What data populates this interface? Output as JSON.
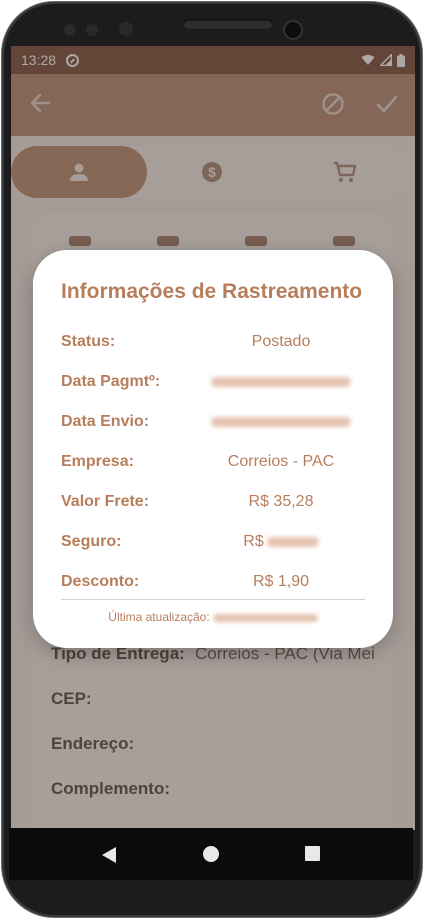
{
  "status_bar": {
    "time": "13:28"
  },
  "dialog": {
    "title": "Informações de Rastreamento",
    "rows": [
      {
        "label": "Status:",
        "value": "Postado"
      },
      {
        "label": "Data Pagmtº:",
        "value": ""
      },
      {
        "label": "Data Envio:",
        "value": ""
      },
      {
        "label": "Empresa:",
        "value": "Correios - PAC"
      },
      {
        "label": "Valor Frete:",
        "value": "R$ 35,28"
      },
      {
        "label": "Seguro:",
        "value": "R$"
      },
      {
        "label": "Desconto:",
        "value": "R$ 1,90"
      }
    ],
    "updated_label": "Última atualização:"
  },
  "background_form": {
    "tipo_entrega_label": "Tipo de Entrega:",
    "tipo_entrega_value": "Correios - PAC (Via Mei",
    "cep_label": "CEP:",
    "endereco_label": "Endereço:",
    "complemento_label": "Complemento:"
  },
  "icons": {
    "back": "arrow-back-icon",
    "cancel": "block-icon",
    "confirm": "check-icon",
    "tab_person": "person-icon",
    "tab_money": "dollar-coin-icon",
    "tab_cart": "shopping-cart-icon"
  },
  "colors": {
    "accent": "#b77e5c",
    "appbar": "#b68a72",
    "statusbar": "#7a4f3a"
  }
}
